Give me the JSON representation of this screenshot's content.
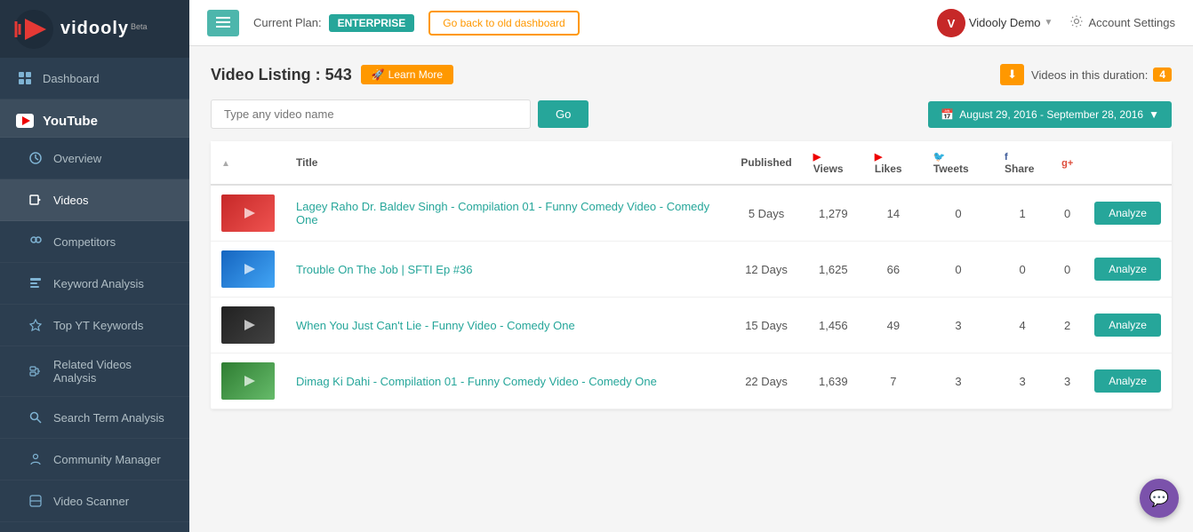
{
  "sidebar": {
    "logo_text": "vidooly",
    "logo_beta": "Beta",
    "items": [
      {
        "id": "dashboard",
        "label": "Dashboard",
        "icon": "dashboard-icon",
        "active": false
      },
      {
        "id": "youtube",
        "label": "YouTube",
        "icon": "youtube-icon",
        "active": true,
        "section": true
      },
      {
        "id": "overview",
        "label": "Overview",
        "icon": "overview-icon",
        "active": false
      },
      {
        "id": "videos",
        "label": "Videos",
        "icon": "videos-icon",
        "active": true
      },
      {
        "id": "competitors",
        "label": "Competitors",
        "icon": "competitors-icon",
        "active": false
      },
      {
        "id": "keyword-analysis",
        "label": "Keyword Analysis",
        "icon": "keyword-icon",
        "active": false
      },
      {
        "id": "top-yt-keywords",
        "label": "Top YT Keywords",
        "icon": "top-keywords-icon",
        "active": false
      },
      {
        "id": "related-videos",
        "label": "Related Videos Analysis",
        "icon": "related-icon",
        "active": false
      },
      {
        "id": "search-term",
        "label": "Search Term Analysis",
        "icon": "search-term-icon",
        "active": false
      },
      {
        "id": "community-manager",
        "label": "Community Manager",
        "icon": "community-icon",
        "active": false
      },
      {
        "id": "video-scanner",
        "label": "Video Scanner",
        "icon": "scanner-icon",
        "active": false
      }
    ]
  },
  "topbar": {
    "menu_label": "☰",
    "current_plan_label": "Current Plan:",
    "plan_name": "ENTERPRISE",
    "go_back_label": "Go back to old dashboard",
    "user_name": "Vidooly Demo",
    "account_setting_label": "Account Settings",
    "user_avatar_initial": "V"
  },
  "main": {
    "title": "Video Listing : 543",
    "learn_more_label": "Learn More",
    "duration_label": "Videos in this duration:",
    "duration_count": "4",
    "search_placeholder": "Type any video name",
    "go_label": "Go",
    "date_range": "August 29, 2016 - September 28, 2016"
  },
  "table": {
    "headers": [
      {
        "id": "thumb",
        "label": ""
      },
      {
        "id": "title",
        "label": "Title"
      },
      {
        "id": "published",
        "label": "Published"
      },
      {
        "id": "views",
        "label": "Views"
      },
      {
        "id": "likes",
        "label": "Likes"
      },
      {
        "id": "tweets",
        "label": "Tweets"
      },
      {
        "id": "share",
        "label": "Share"
      },
      {
        "id": "gplus",
        "label": ""
      },
      {
        "id": "action",
        "label": ""
      }
    ],
    "rows": [
      {
        "id": 1,
        "title": "Lagey Raho Dr. Baldev Singh - Compilation 01 - Funny Comedy Video - Comedy One",
        "published": "5 Days",
        "views": "1,279",
        "likes": "14",
        "tweets": "0",
        "share": "1",
        "gplus": "0",
        "thumb_class": "thumb-1",
        "analyze_label": "Analyze"
      },
      {
        "id": 2,
        "title": "Trouble On The Job | SFTI Ep #36",
        "published": "12 Days",
        "views": "1,625",
        "likes": "66",
        "tweets": "0",
        "share": "0",
        "gplus": "0",
        "thumb_class": "thumb-2",
        "analyze_label": "Analyze"
      },
      {
        "id": 3,
        "title": "When You Just Can't Lie - Funny Video - Comedy One",
        "published": "15 Days",
        "views": "1,456",
        "likes": "49",
        "tweets": "3",
        "share": "4",
        "gplus": "2",
        "thumb_class": "thumb-3",
        "analyze_label": "Analyze"
      },
      {
        "id": 4,
        "title": "Dimag Ki Dahi - Compilation 01 - Funny Comedy Video - Comedy One",
        "published": "22 Days",
        "views": "1,639",
        "likes": "7",
        "tweets": "3",
        "share": "3",
        "gplus": "3",
        "thumb_class": "thumb-4",
        "analyze_label": "Analyze"
      }
    ]
  },
  "colors": {
    "primary": "#26a69a",
    "orange": "#ff9800",
    "sidebar_bg": "#2c3e50"
  }
}
